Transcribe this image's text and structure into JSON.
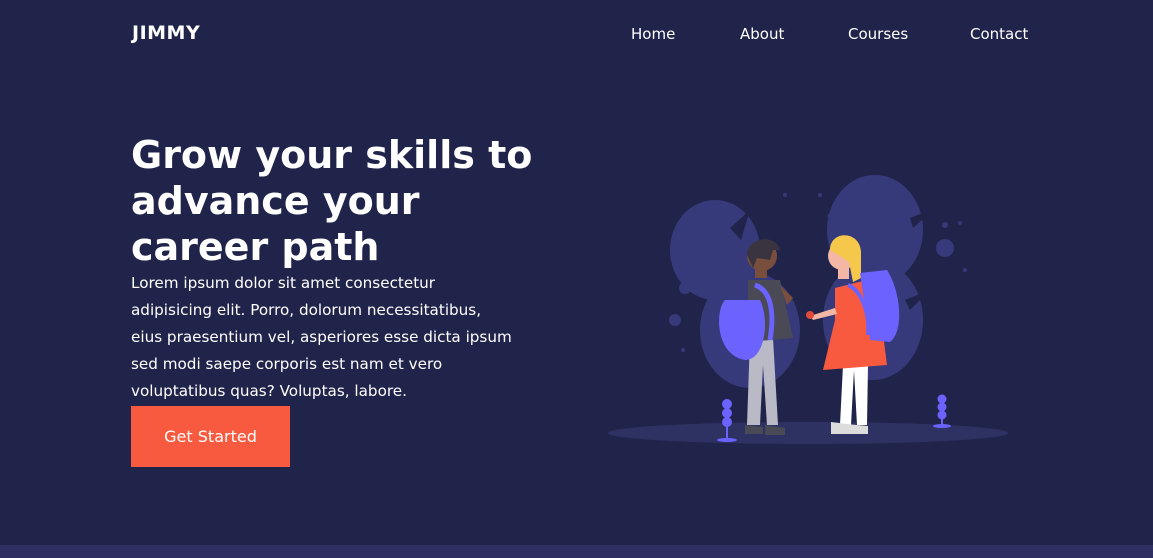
{
  "header": {
    "logo": "JIMMY",
    "nav": [
      {
        "label": "Home"
      },
      {
        "label": "About"
      },
      {
        "label": "Courses"
      },
      {
        "label": "Contact"
      }
    ]
  },
  "hero": {
    "title_lines": [
      "Grow your skills to",
      "advance your",
      "career path"
    ],
    "paragraph_lines": [
      "Lorem ipsum dolor sit amet consectetur",
      "adipisicing elit. Porro, dolorum necessitatibus,",
      "eius praesentium vel, asperiores esse dicta ipsum",
      "sed modi saepe corporis est nam et vero",
      "voluptatibus quas? Voluptas, labore."
    ],
    "cta_label": "Get Started"
  },
  "colors": {
    "background": "#21244a",
    "accent": "#f85a40",
    "illustration_blob": "#363a7a",
    "illustration_purple": "#6c63ff"
  },
  "icons": {
    "hero_illustration": "students-with-backpacks-illustration"
  }
}
